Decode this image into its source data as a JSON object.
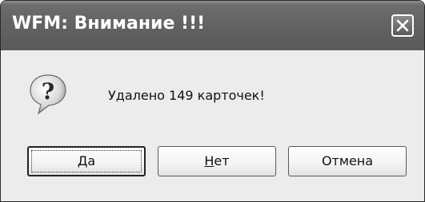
{
  "window": {
    "title": "WFM: Внимание !!!",
    "close_icon": "close-icon"
  },
  "dialog": {
    "icon": "question-icon",
    "message": "Удалено 149 карточек!"
  },
  "buttons": {
    "yes": {
      "mnemonic": "Д",
      "rest": "а"
    },
    "no": {
      "mnemonic": "Н",
      "rest": "ет"
    },
    "cancel": {
      "label": "Отмена"
    }
  }
}
